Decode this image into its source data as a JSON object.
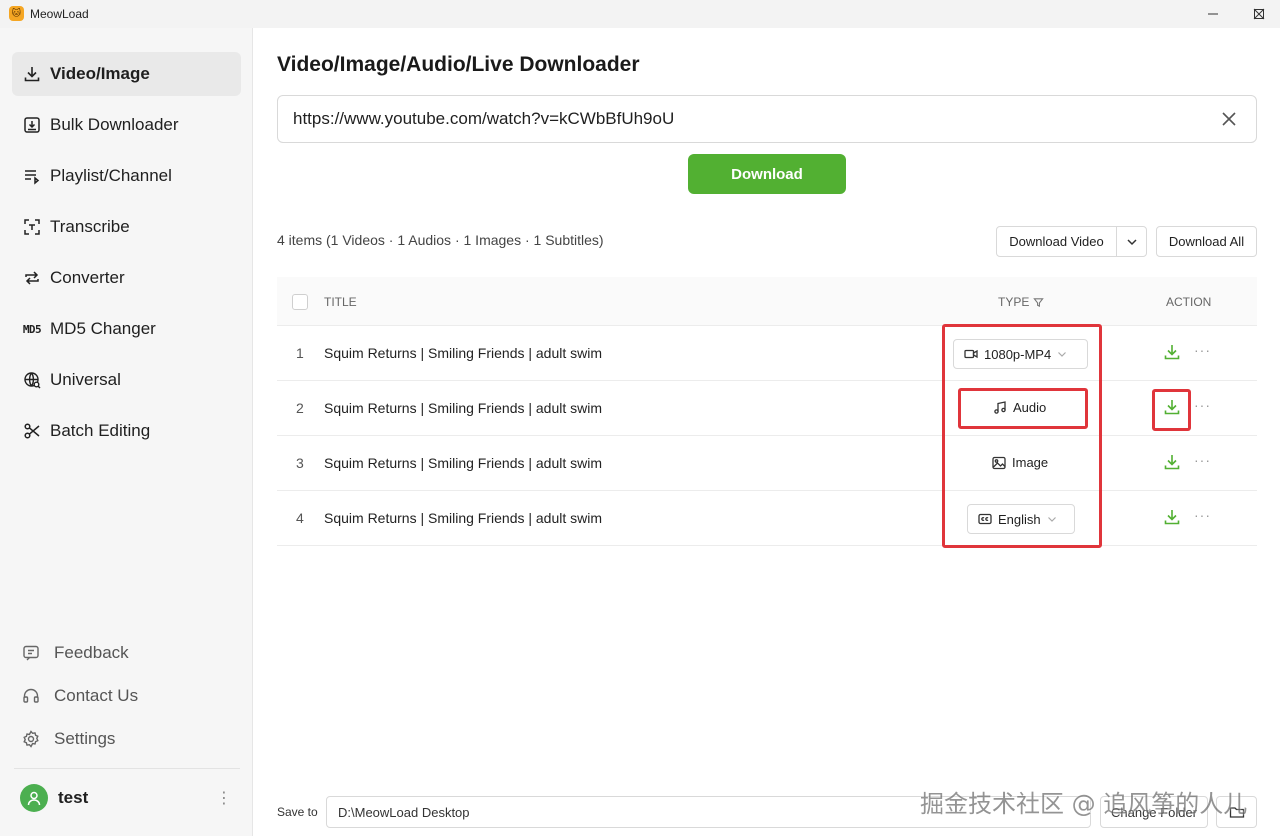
{
  "app": {
    "title": "MeowLoad",
    "logo_glyph": "🐱"
  },
  "window_controls": [
    "minimize-icon",
    "maximize-icon",
    "close-icon"
  ],
  "sidebar": {
    "items": [
      {
        "label": "Video/Image",
        "icon": "download-icon",
        "active": true
      },
      {
        "label": "Bulk Downloader",
        "icon": "bulk-download-icon",
        "active": false
      },
      {
        "label": "Playlist/Channel",
        "icon": "playlist-icon",
        "active": false
      },
      {
        "label": "Transcribe",
        "icon": "transcribe-icon",
        "active": false
      },
      {
        "label": "Converter",
        "icon": "convert-icon",
        "active": false
      },
      {
        "label": "MD5 Changer",
        "icon": "md5-icon",
        "icon_text": "MD5",
        "active": false
      },
      {
        "label": "Universal",
        "icon": "globe-icon",
        "active": false
      },
      {
        "label": "Batch Editing",
        "icon": "scissors-icon",
        "active": false
      }
    ],
    "footer": [
      {
        "label": "Feedback",
        "icon": "feedback-icon"
      },
      {
        "label": "Contact Us",
        "icon": "headset-icon"
      },
      {
        "label": "Settings",
        "icon": "gear-icon"
      }
    ],
    "user": {
      "name": "test",
      "menu_glyph": "⋮"
    }
  },
  "main": {
    "title": "Video/Image/Audio/Live Downloader",
    "url_value": "https://www.youtube.com/watch?v=kCWbBfUh9oU",
    "download_label": "Download",
    "summary": "4 items (1 Videos · 1 Audios · 1 Images · 1 Subtitles)",
    "download_video_label": "Download Video",
    "download_all_label": "Download All",
    "table": {
      "headers": {
        "title": "TITLE",
        "type": "TYPE",
        "action": "ACTION"
      },
      "rows": [
        {
          "num": "1",
          "title": "Squim Returns | Smiling Friends | adult swim",
          "type": "1080p-MP4",
          "type_icon": "video-icon",
          "selectable": true
        },
        {
          "num": "2",
          "title": "Squim Returns | Smiling Friends | adult swim",
          "type": "Audio",
          "type_icon": "music-icon",
          "selectable": false
        },
        {
          "num": "3",
          "title": "Squim Returns | Smiling Friends | adult swim",
          "type": "Image",
          "type_icon": "image-icon",
          "selectable": false
        },
        {
          "num": "4",
          "title": "Squim Returns | Smiling Friends | adult swim",
          "type": "English",
          "type_icon": "cc-icon",
          "selectable": true
        }
      ],
      "more_glyph": "···"
    }
  },
  "footer": {
    "save_label": "Save to",
    "save_path": "D:\\MeowLoad Desktop",
    "change_folder_label": "Change Folder"
  },
  "watermark": "掘金技术社区 @ 追风筝的人儿",
  "colors": {
    "accent": "#52b032",
    "highlight": "#e0353b"
  }
}
